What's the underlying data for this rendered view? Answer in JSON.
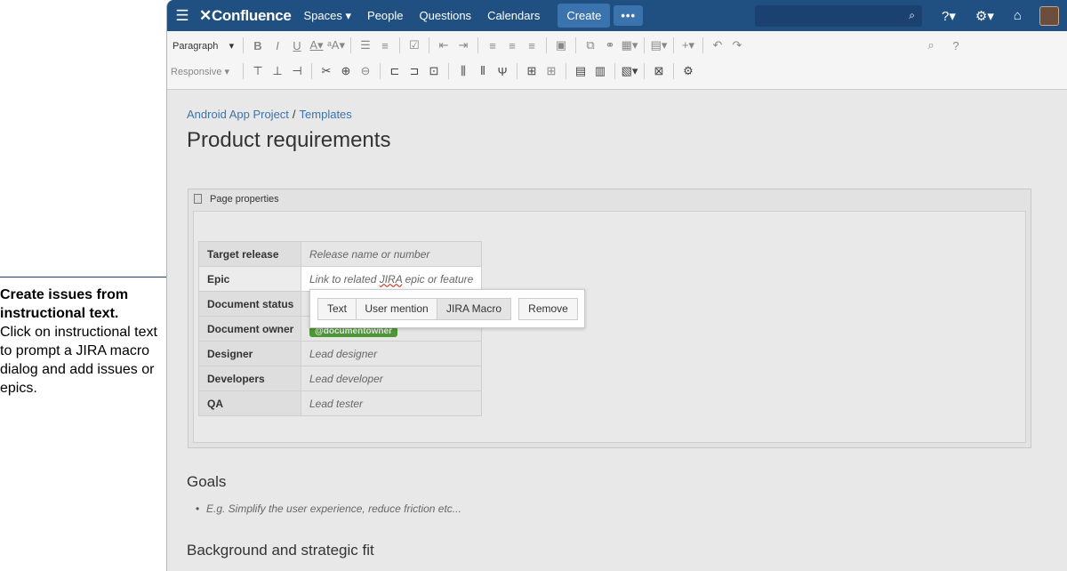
{
  "callout": {
    "title": "Create issues from instructional text.",
    "body": "Click on instructional text to prompt a JIRA macro dialog and add issues or epics."
  },
  "header": {
    "logo": "Confluence",
    "nav": [
      "Spaces",
      "People",
      "Questions",
      "Calendars"
    ],
    "create": "Create",
    "more": "•••"
  },
  "toolbar": {
    "paragraph": "Paragraph",
    "responsive": "Responsive"
  },
  "breadcrumb": {
    "space": "Android App Project",
    "parent": "Templates"
  },
  "page_title": "Product requirements",
  "macro": {
    "title": "Page properties"
  },
  "properties": [
    {
      "key": "Target release",
      "value": "Release name or number"
    },
    {
      "key": "Epic",
      "value_pre": "Link to related ",
      "value_jira": "JIRA",
      "value_post": " epic or feature"
    },
    {
      "key": "Document status",
      "value": ""
    },
    {
      "key": "Document owner",
      "value": "@documentowner"
    },
    {
      "key": "Designer",
      "value": "Lead designer"
    },
    {
      "key": "Developers",
      "value": "Lead developer"
    },
    {
      "key": "QA",
      "value": "Lead tester"
    }
  ],
  "popup": {
    "buttons": [
      "Text",
      "User mention",
      "JIRA Macro",
      "Remove"
    ]
  },
  "goals": {
    "heading": "Goals",
    "items": [
      "E.g. Simplify the user experience, reduce friction etc..."
    ]
  },
  "background": {
    "heading": "Background and strategic fit"
  },
  "colors": {
    "header_bg": "#205081",
    "create_bg": "#3b73af",
    "link": "#3b73af",
    "lozenge": "#4d9734",
    "callout": "#1d3f74"
  }
}
